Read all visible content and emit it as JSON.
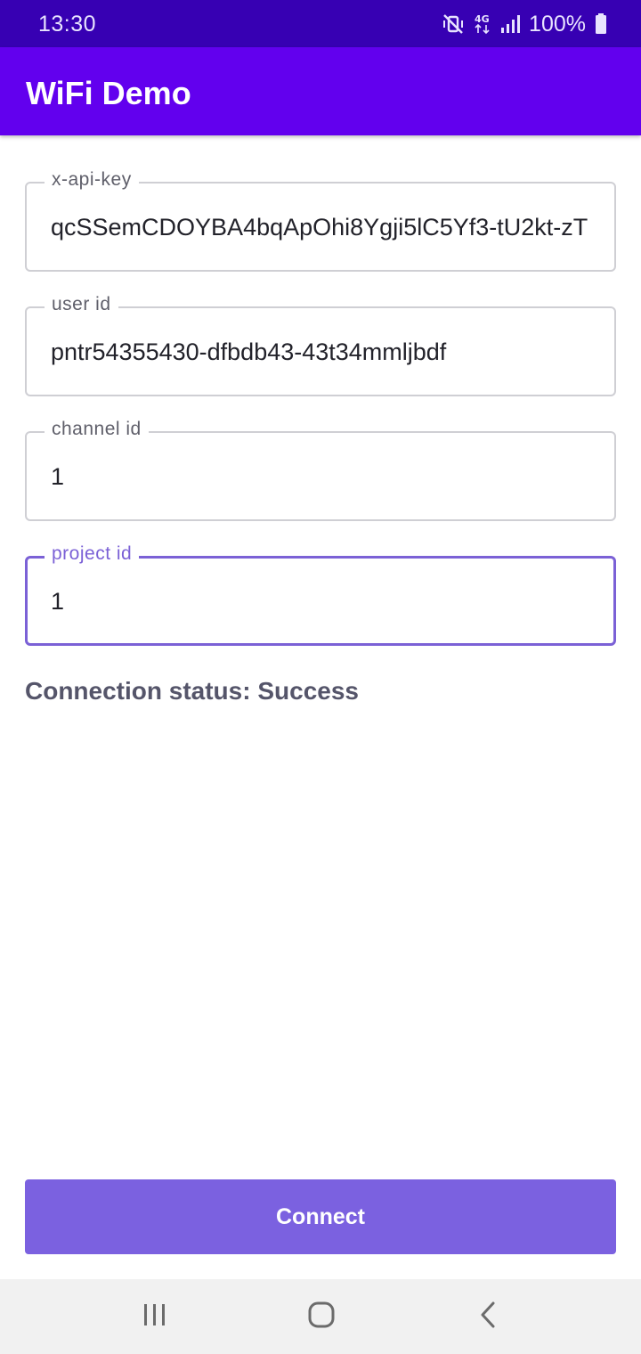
{
  "status_bar": {
    "time": "13:30",
    "battery": "100%",
    "icons": [
      "mute-vibrate-icon",
      "4g-data-icon",
      "signal-icon",
      "battery-icon"
    ]
  },
  "app_bar": {
    "title": "WiFi Demo"
  },
  "form": {
    "api_key": {
      "label": "x-api-key",
      "value": "qcSSemCDOYBA4bqApOhi8Ygji5lC5Yf3-tU2kt-zT"
    },
    "user_id": {
      "label": "user id",
      "value": "pntr54355430-dfbdb43-43t34mmljbdf"
    },
    "channel_id": {
      "label": "channel id",
      "value": "1"
    },
    "project_id": {
      "label": "project id",
      "value": "1"
    }
  },
  "connection_status": "Connection status: Success",
  "connect_button": "Connect",
  "nav": {
    "icons": [
      "recent-apps-icon",
      "home-icon",
      "back-icon"
    ]
  },
  "colors": {
    "status_bar": "#3700b3",
    "app_bar": "#6200ee",
    "accent": "#7b61d6",
    "button": "#7b61e0"
  }
}
